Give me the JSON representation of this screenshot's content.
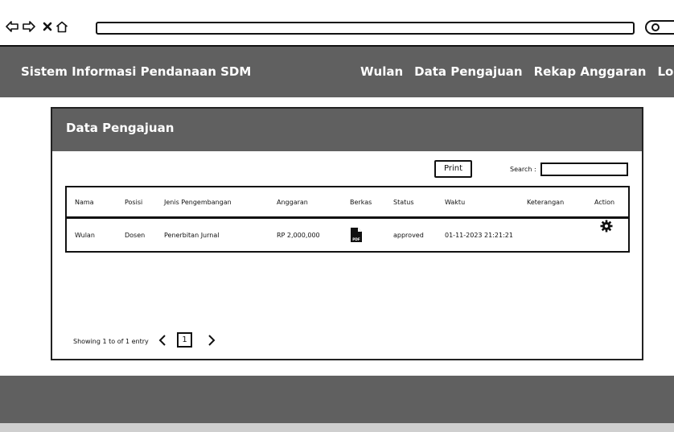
{
  "navbar": {
    "brand": "Sistem Informasi Pendanaan SDM",
    "links": [
      "Wulan",
      "Data Pengajuan",
      "Rekap Anggaran",
      "Logout"
    ]
  },
  "panel": {
    "title": "Data Pengajuan",
    "print_label": "Print",
    "search_label": "Search :",
    "search_value": ""
  },
  "table": {
    "headers": [
      "Nama",
      "Posisi",
      "Jenis Pengembangan",
      "Anggaran",
      "Berkas",
      "Status",
      "Waktu",
      "Keterangan",
      "Action"
    ],
    "rows": [
      {
        "nama": "Wulan",
        "posisi": "Dosen",
        "jenis": "Penerbitan Jurnal",
        "anggaran": "RP 2,000,000",
        "berkas_icon": "pdf-file-icon",
        "status": "approved",
        "waktu": "01-11-2023 21:21:21",
        "keterangan": "",
        "action_icon": "gear-icon"
      }
    ]
  },
  "pagination": {
    "info": "Showing 1 to of 1 entry",
    "current_page": "1"
  },
  "colors": {
    "bar": "#606060",
    "text_light": "#ffffff",
    "border": "#111111"
  }
}
